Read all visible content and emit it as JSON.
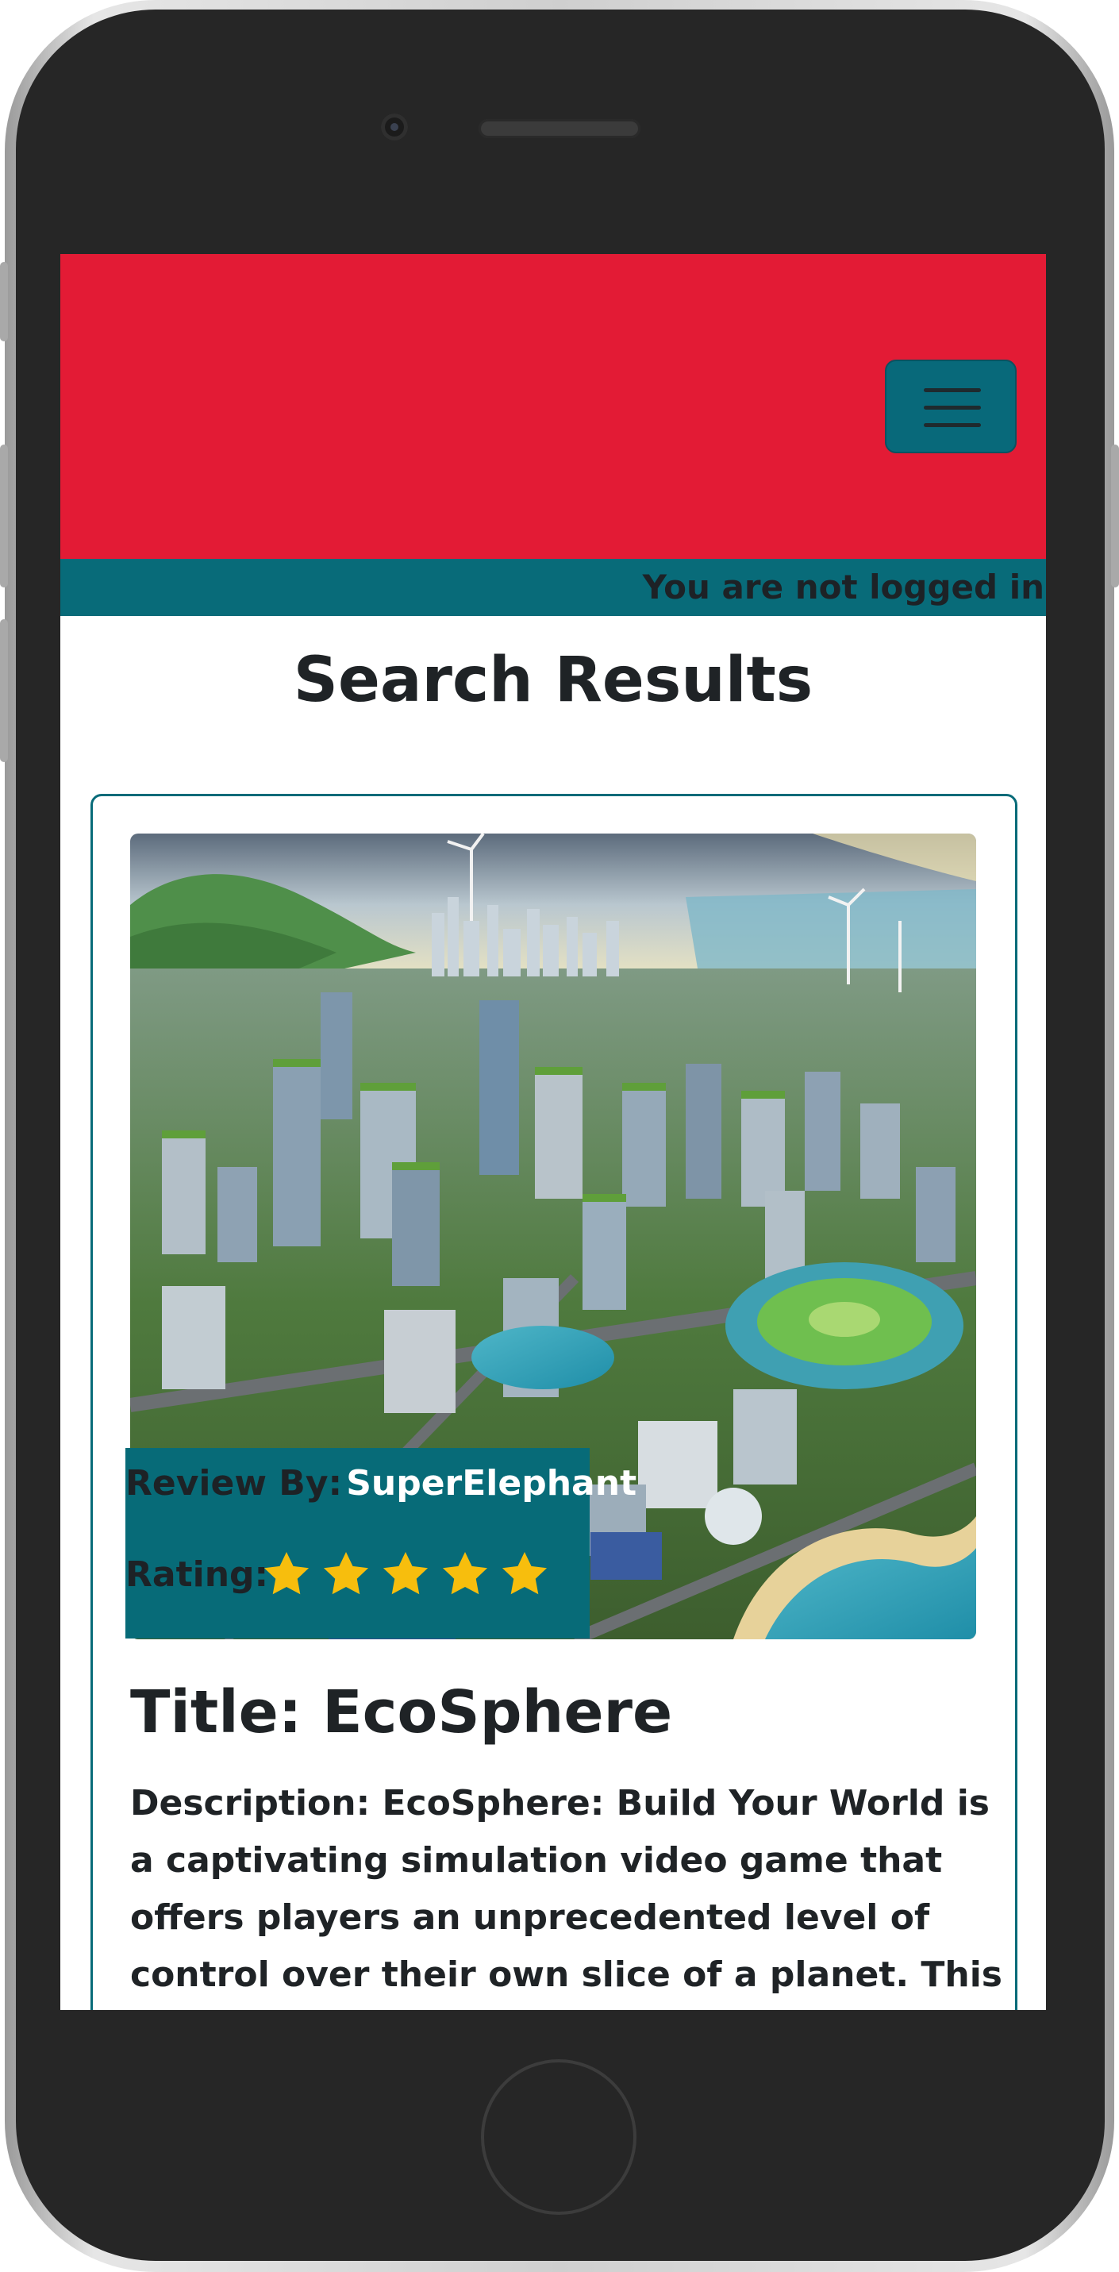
{
  "device": {
    "name": "phone mockup"
  },
  "header": {
    "menu_icon": "hamburger-menu-icon",
    "brand_color": "#e31b35",
    "accent_color": "#086b79"
  },
  "status_strip": {
    "text": "You are not logged in"
  },
  "page": {
    "title": "Search Results"
  },
  "review": {
    "image_icon": "city-cover-image",
    "reviewer_label": "Review By:",
    "reviewer_name": "SuperElephant",
    "rating_label": "Rating:",
    "rating": 5,
    "rating_max": 5,
    "star_icon": "star-icon",
    "star_color": "#f7be0d",
    "title": "Title: EcoSphere",
    "description": "Description: EcoSphere: Build Your World is a captivating simulation video game that offers players an unprecedented level of control over their own slice of a planet. This game"
  }
}
